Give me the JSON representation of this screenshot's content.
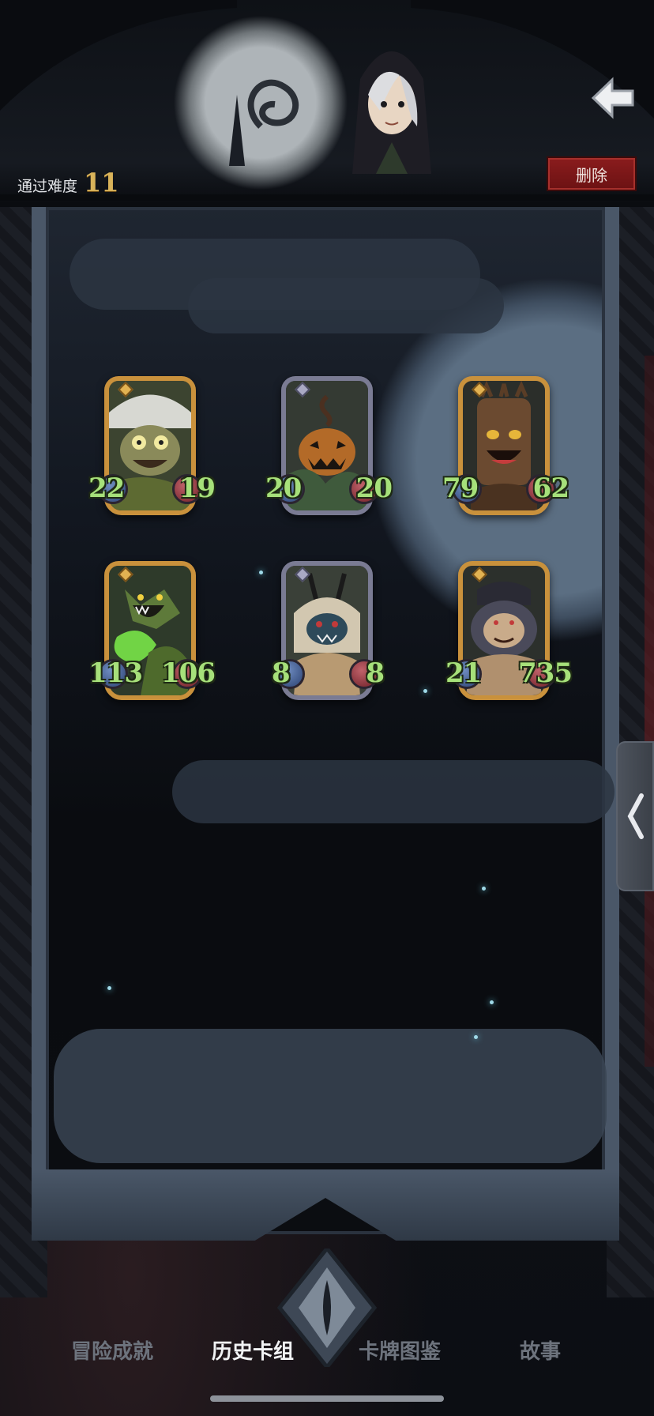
{
  "header": {
    "difficulty_label": "通过难度",
    "difficulty_value": "11",
    "delete_label": "删除",
    "back_icon": "arrow-left-icon"
  },
  "cards": [
    {
      "rarity": "gold",
      "attack": "22",
      "health": "19",
      "art": "mushroom-frog-monster"
    },
    {
      "rarity": "rare",
      "attack": "20",
      "health": "20",
      "art": "pumpkin-monster"
    },
    {
      "rarity": "gold",
      "attack": "79",
      "health": "62",
      "art": "tree-golem"
    },
    {
      "rarity": "gold",
      "attack": "113",
      "health": "106",
      "art": "slime-dragon"
    },
    {
      "rarity": "rare",
      "attack": "8",
      "health": "8",
      "art": "horned-beast"
    },
    {
      "rarity": "gold",
      "attack": "21",
      "health": "735",
      "art": "gorilla-brute"
    }
  ],
  "side_handle": {
    "icon": "chevron-left-icon"
  },
  "tabs": [
    {
      "label": "冒险成就",
      "active": false
    },
    {
      "label": "历史卡组",
      "active": true
    },
    {
      "label": "卡牌图鉴",
      "active": false
    },
    {
      "label": "故事",
      "active": false
    }
  ],
  "colors": {
    "stat_text": "#a6e07a",
    "gold_frame": "#c9913c",
    "rare_frame": "#7a7b93",
    "delete_bg": "#8a1c1d",
    "difficulty": "#d9b35a"
  }
}
